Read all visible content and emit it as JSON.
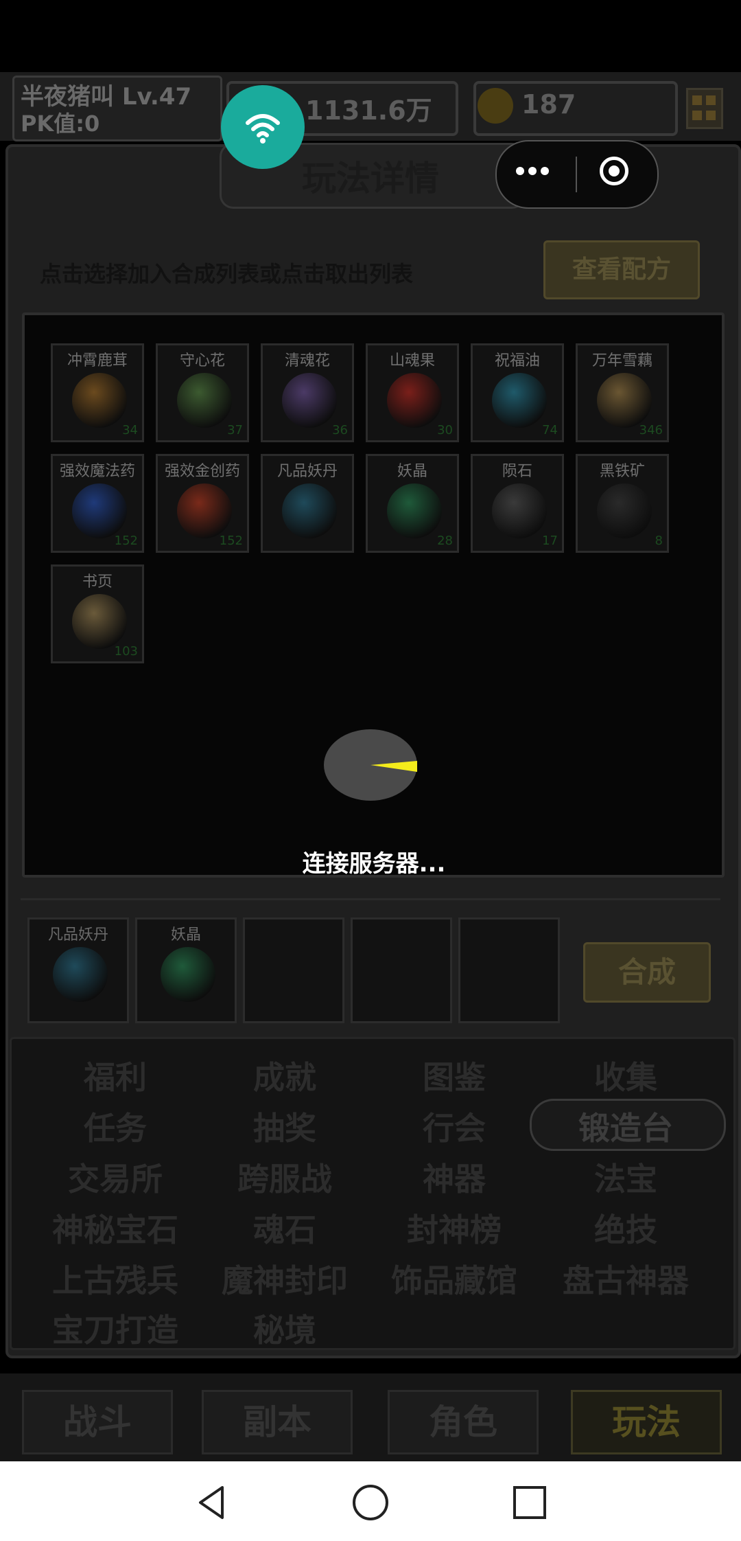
{
  "header": {
    "player_name": "半夜猪叫 Lv.47",
    "pk_value": "PK值:0",
    "coins": "1131.6万",
    "gold": "187"
  },
  "panel": {
    "title": "玩法详情",
    "hint": "点击选择加入合成列表或点击取出列表",
    "recipe_button": "查看配方"
  },
  "items": [
    {
      "name": "冲霄鹿茸",
      "count": "34",
      "color": "#6b4a1e"
    },
    {
      "name": "守心花",
      "count": "37",
      "color": "#3c5a30"
    },
    {
      "name": "清魂花",
      "count": "36",
      "color": "#4b3a66"
    },
    {
      "name": "山魂果",
      "count": "30",
      "color": "#7a1f1a"
    },
    {
      "name": "祝福油",
      "count": "74",
      "color": "#1f5a6a"
    },
    {
      "name": "万年雪藕",
      "count": "346",
      "color": "#6a5632"
    },
    {
      "name": "强效魔法药",
      "count": "152",
      "color": "#1f3a7a"
    },
    {
      "name": "强效金创药",
      "count": "152",
      "color": "#7a2a1a"
    },
    {
      "name": "凡品妖丹",
      "count": "",
      "color": "#1f4a5a"
    },
    {
      "name": "妖晶",
      "count": "28",
      "color": "#1f5a3a"
    },
    {
      "name": "陨石",
      "count": "17",
      "color": "#3a3a3a"
    },
    {
      "name": "黑铁矿",
      "count": "8",
      "color": "#2a2a2a"
    },
    {
      "name": "书页",
      "count": "103",
      "color": "#6a5a3a"
    }
  ],
  "loading_text": "连接服务器...",
  "selected_slots": [
    {
      "name": "凡品妖丹",
      "color": "#1f4a5a"
    },
    {
      "name": "妖晶",
      "color": "#1f5a3a"
    },
    {
      "name": "",
      "color": ""
    },
    {
      "name": "",
      "color": ""
    },
    {
      "name": "",
      "color": ""
    }
  ],
  "combine_button": "合成",
  "menu": [
    [
      "福利",
      "成就",
      "图鉴",
      "收集"
    ],
    [
      "任务",
      "抽奖",
      "行会",
      "锻造台"
    ],
    [
      "交易所",
      "跨服战",
      "神器",
      "法宝"
    ],
    [
      "神秘宝石",
      "魂石",
      "封神榜",
      "绝技"
    ],
    [
      "上古残兵",
      "魔神封印",
      "饰品藏馆",
      "盘古神器"
    ],
    [
      "宝刀打造",
      "秘境",
      "",
      ""
    ]
  ],
  "active_menu": "锻造台",
  "tabs": [
    "战斗",
    "副本",
    "角色",
    "玩法"
  ],
  "active_tab": "玩法"
}
